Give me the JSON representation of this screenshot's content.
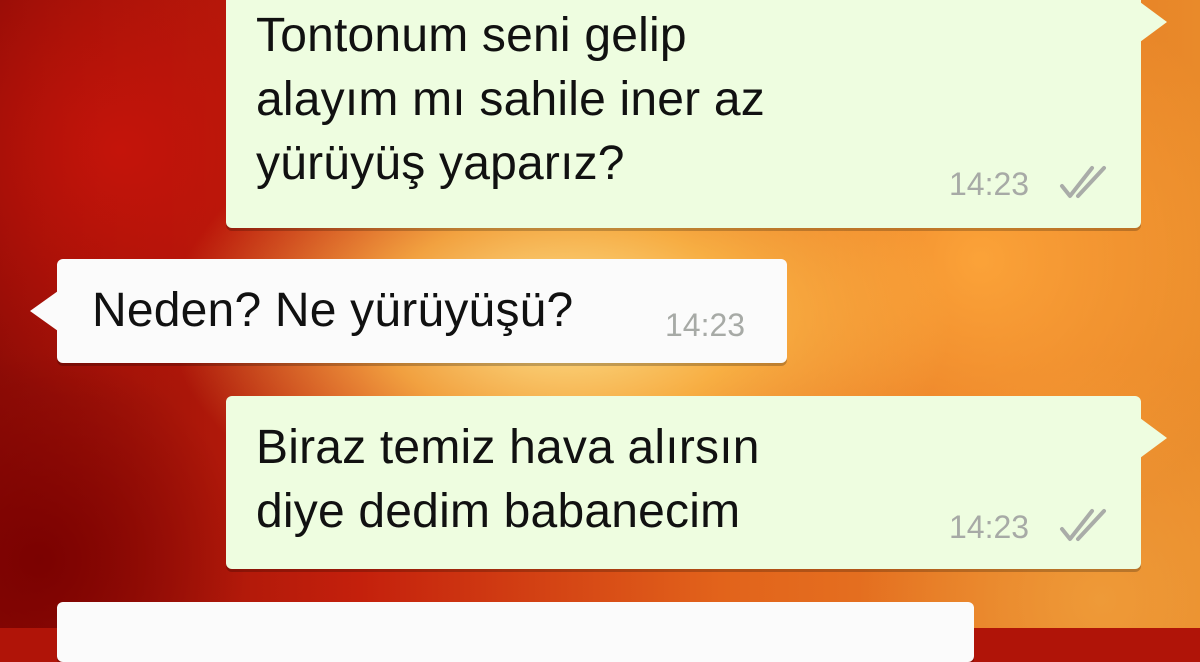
{
  "chat": {
    "messages": [
      {
        "direction": "outgoing",
        "text": "Tontonum seni gelip\nalayım mı sahile iner az\nyürüyüş yaparız?",
        "time": "14:23",
        "status_icon": "double-check-icon"
      },
      {
        "direction": "incoming",
        "text": "Neden? Ne yürüyüşü?",
        "time": "14:23"
      },
      {
        "direction": "outgoing",
        "text": "Biraz temiz hava alırsın\ndiye dedim babanecim",
        "time": "14:23",
        "status_icon": "double-check-icon"
      },
      {
        "direction": "incoming",
        "text": ""
      }
    ]
  },
  "colors": {
    "outgoing_bubble": "#eefde0",
    "incoming_bubble": "#fbfbfb",
    "timestamp": "#a7aaa6",
    "tick": "#a9aca8"
  }
}
